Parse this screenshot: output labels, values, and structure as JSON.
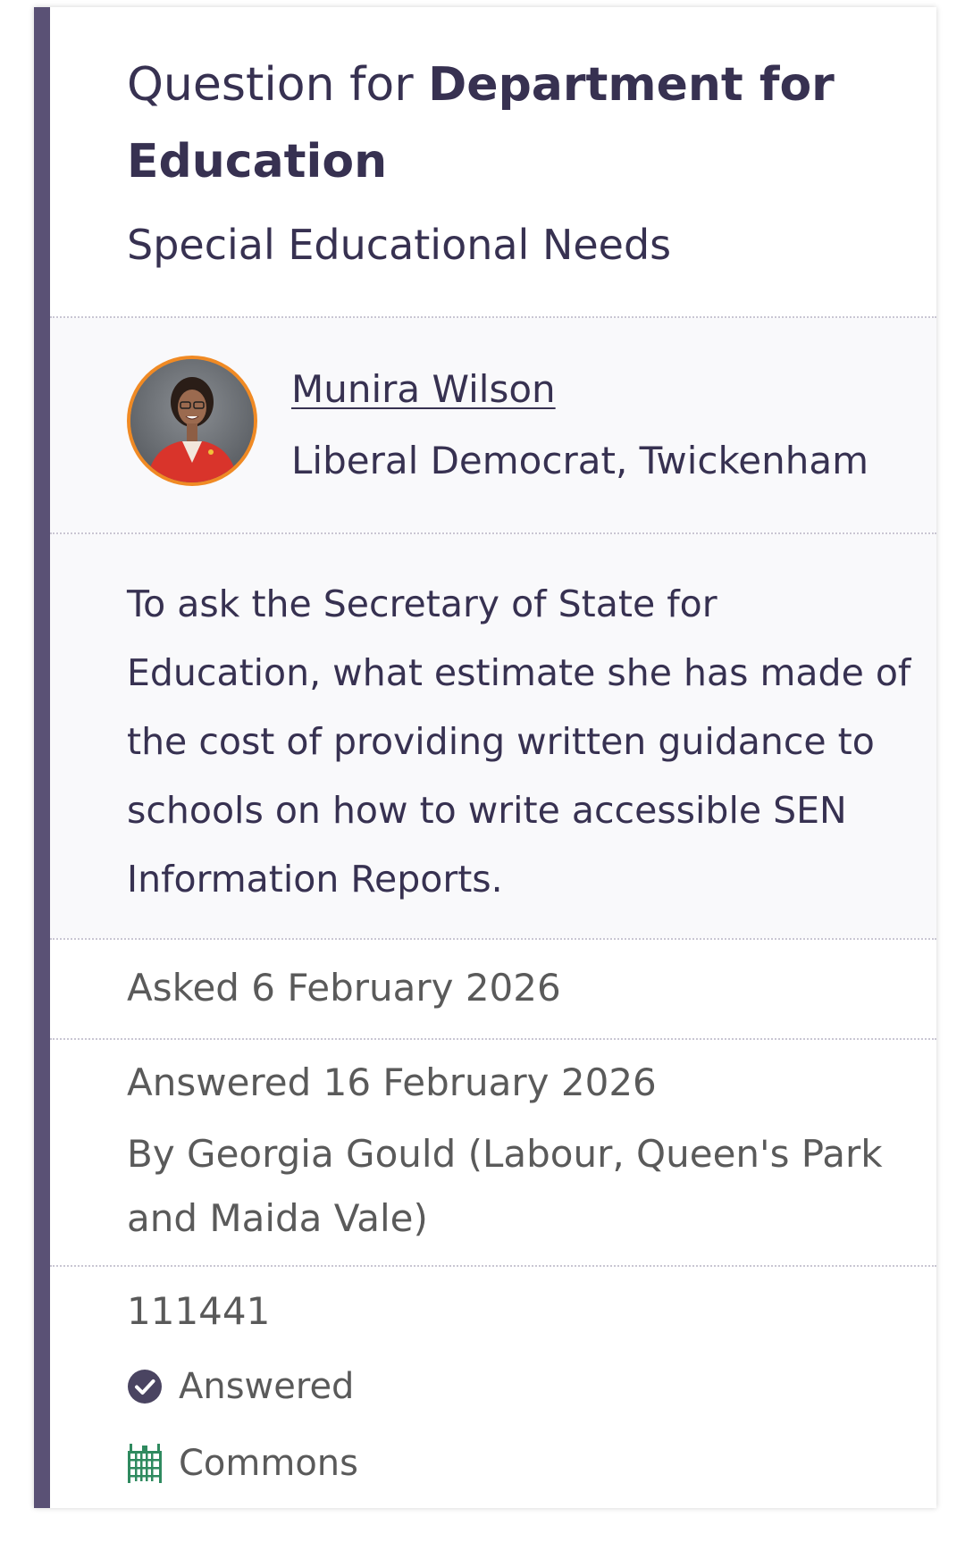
{
  "question": {
    "title_prefix": "Question for",
    "department": "Department for Education",
    "subject": "Special Educational Needs"
  },
  "member": {
    "name": "Munira Wilson",
    "party_constituency": "Liberal Democrat, Twickenham",
    "avatar_icon": "member-portrait"
  },
  "body": {
    "text": "To ask the Secretary of State for Education, what estimate she has made of the cost of providing written guidance to schools on how to write accessible SEN Information Reports."
  },
  "asked": {
    "label": "Asked 6 February 2026"
  },
  "answered": {
    "date_label": "Answered 16 February 2026",
    "by_label": "By Georgia Gould (Labour, Queen's Park and Maida Vale)"
  },
  "footer": {
    "uin": "111441",
    "status_label": "Answered",
    "status_icon": "check-circle-icon",
    "house_label": "Commons",
    "house_icon": "portcullis-icon"
  },
  "colors": {
    "accent_bar": "#5a5175",
    "avatar_ring": "#f08a24",
    "commons_green": "#2f8a5f",
    "text_dark": "#373151"
  }
}
